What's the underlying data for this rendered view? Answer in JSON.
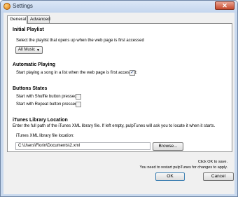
{
  "window": {
    "title": "Settings",
    "close_glyph": "✕"
  },
  "tabs": [
    {
      "label": "General",
      "active": true
    },
    {
      "label": "Advanced",
      "active": false
    }
  ],
  "initial_playlist": {
    "title": "Initial Playlist",
    "description": "Select the playlist that opens up when the web page is first accessed",
    "selected": "All Music",
    "arrow_glyph": "▼"
  },
  "automatic_playing": {
    "title": "Automatic Playing",
    "label": "Start playing a song in a list when the web page is first accessed:",
    "checked": true
  },
  "buttons_states": {
    "title": "Buttons States",
    "shuffle_label": "Start with Shuffle button pressed:",
    "shuffle_checked": false,
    "repeat_label": "Start with Repeat button pressed:",
    "repeat_checked": false
  },
  "itunes": {
    "title": "iTunes Library Location",
    "description": "Enter the full path of the iTunes XML library file. If left empty, pulpTunes will ask you to locate it when it starts.",
    "field_label": "iTunes XML library file location:",
    "path_value": "C:\\Users\\Florin\\Documents\\2.xml",
    "browse_label": "Browse..."
  },
  "footer": {
    "info_line1": "Click OK to save.",
    "info_line2": "You need to restart pulpTunes for changes to apply.",
    "ok_label": "OK",
    "cancel_label": "Cancel"
  },
  "check_glyph": "✓"
}
